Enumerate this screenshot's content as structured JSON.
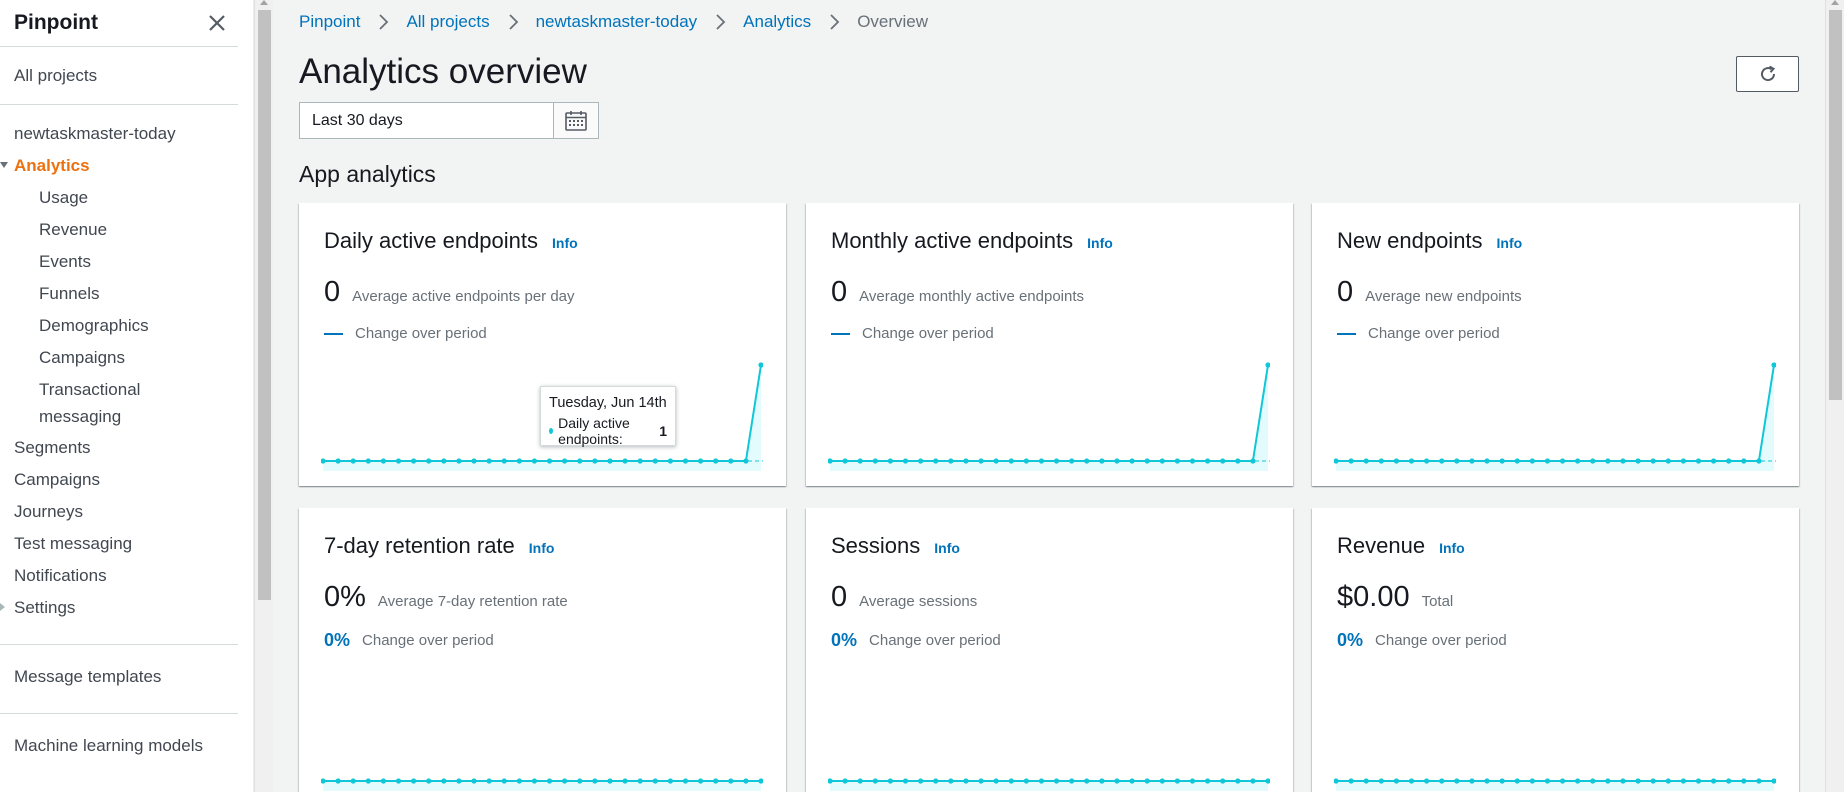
{
  "sidebar": {
    "title": "Pinpoint",
    "all_projects": "All projects",
    "project_name": "newtaskmaster-today",
    "analytics": "Analytics",
    "analytics_items": [
      "Usage",
      "Revenue",
      "Events",
      "Funnels",
      "Demographics",
      "Campaigns",
      "Transactional messaging"
    ],
    "items": [
      "Segments",
      "Campaigns",
      "Journeys",
      "Test messaging",
      "Notifications",
      "Settings"
    ],
    "message_templates": "Message templates",
    "ml_models": "Machine learning models"
  },
  "breadcrumb": [
    "Pinpoint",
    "All projects",
    "newtaskmaster-today",
    "Analytics",
    "Overview"
  ],
  "page_title": "Analytics overview",
  "date_range": "Last 30 days",
  "section_title": "App analytics",
  "cards": [
    {
      "title": "Daily active endpoints",
      "info": "Info",
      "value": "0",
      "label": "Average active endpoints per day",
      "change_label": "Change over period"
    },
    {
      "title": "Monthly active endpoints",
      "info": "Info",
      "value": "0",
      "label": "Average monthly active endpoints",
      "change_label": "Change over period"
    },
    {
      "title": "New endpoints",
      "info": "Info",
      "value": "0",
      "label": "Average new endpoints",
      "change_label": "Change over period"
    },
    {
      "title": "7-day retention rate",
      "info": "Info",
      "value": "0%",
      "label": "Average 7-day retention rate",
      "change_pct": "0%",
      "change_label": "Change over period"
    },
    {
      "title": "Sessions",
      "info": "Info",
      "value": "0",
      "label": "Average sessions",
      "change_pct": "0%",
      "change_label": "Change over period"
    },
    {
      "title": "Revenue",
      "info": "Info",
      "value": "$0.00",
      "label": "Total",
      "change_pct": "0%",
      "change_label": "Change over period"
    }
  ],
  "tooltip": {
    "date": "Tuesday, Jun 14th",
    "series": "Daily active endpoints:",
    "value": "1"
  },
  "colors": {
    "accent": "#0073bb",
    "active_nav": "#ec7211",
    "series": "#0fc7d8"
  },
  "chart_data": [
    {
      "type": "line",
      "series": [
        {
          "values": [
            0,
            0,
            0,
            0,
            0,
            0,
            0,
            0,
            0,
            0,
            0,
            0,
            0,
            0,
            0,
            0,
            0,
            0,
            0,
            0,
            0,
            0,
            0,
            0,
            0,
            0,
            0,
            0,
            0,
            1
          ]
        }
      ]
    },
    {
      "type": "line",
      "series": [
        {
          "values": [
            0,
            0,
            0,
            0,
            0,
            0,
            0,
            0,
            0,
            0,
            0,
            0,
            0,
            0,
            0,
            0,
            0,
            0,
            0,
            0,
            0,
            0,
            0,
            0,
            0,
            0,
            0,
            0,
            0,
            1
          ]
        }
      ]
    },
    {
      "type": "line",
      "series": [
        {
          "values": [
            0,
            0,
            0,
            0,
            0,
            0,
            0,
            0,
            0,
            0,
            0,
            0,
            0,
            0,
            0,
            0,
            0,
            0,
            0,
            0,
            0,
            0,
            0,
            0,
            0,
            0,
            0,
            0,
            0,
            1
          ]
        }
      ]
    },
    {
      "type": "line",
      "series": [
        {
          "values": [
            0,
            0,
            0,
            0,
            0,
            0,
            0,
            0,
            0,
            0,
            0,
            0,
            0,
            0,
            0,
            0,
            0,
            0,
            0,
            0,
            0,
            0,
            0,
            0,
            0,
            0,
            0,
            0,
            0,
            0
          ]
        }
      ]
    },
    {
      "type": "line",
      "series": [
        {
          "values": [
            0,
            0,
            0,
            0,
            0,
            0,
            0,
            0,
            0,
            0,
            0,
            0,
            0,
            0,
            0,
            0,
            0,
            0,
            0,
            0,
            0,
            0,
            0,
            0,
            0,
            0,
            0,
            0,
            0,
            0
          ]
        }
      ]
    },
    {
      "type": "line",
      "series": [
        {
          "values": [
            0,
            0,
            0,
            0,
            0,
            0,
            0,
            0,
            0,
            0,
            0,
            0,
            0,
            0,
            0,
            0,
            0,
            0,
            0,
            0,
            0,
            0,
            0,
            0,
            0,
            0,
            0,
            0,
            0,
            0
          ]
        }
      ]
    }
  ]
}
